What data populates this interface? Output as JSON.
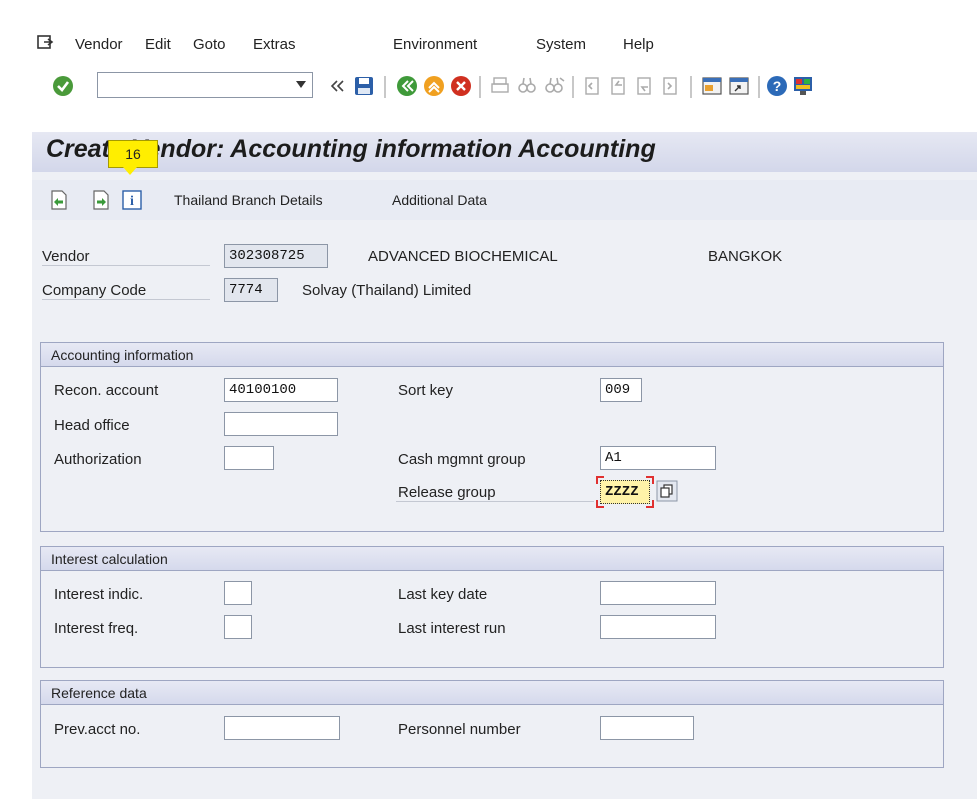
{
  "menu": {
    "items": [
      "Vendor",
      "Edit",
      "Goto",
      "Extras",
      "Environment",
      "System",
      "Help"
    ]
  },
  "toolbar": {
    "command_field_value": "",
    "icons": [
      "enter-icon",
      "command-dropdown-icon",
      "collapse-icon",
      "save-icon",
      "back-icon",
      "exit-icon",
      "cancel-icon",
      "print-icon",
      "find-icon",
      "find-next-icon",
      "first-page-icon",
      "previous-page-icon",
      "next-page-icon",
      "last-page-icon",
      "new-session-icon",
      "shortcut-icon",
      "help-icon",
      "layout-icon"
    ]
  },
  "screen": {
    "title": "Create Vendor: Accounting information Accounting",
    "tooltip": "16"
  },
  "app_toolbar": {
    "icons": [
      "previous-screen-icon",
      "next-screen-icon",
      "info-icon"
    ],
    "buttons": [
      "Thailand Branch Details",
      "Additional Data"
    ]
  },
  "header": {
    "vendor_label": "Vendor",
    "vendor_number": "302308725",
    "vendor_name": "ADVANCED BIOCHEMICAL",
    "vendor_city": "BANGKOK",
    "company_code_label": "Company Code",
    "company_code": "7774",
    "company_name": "Solvay (Thailand) Limited"
  },
  "accounting_info": {
    "title": "Accounting information",
    "recon_account_label": "Recon. account",
    "recon_account": "40100100",
    "head_office_label": "Head office",
    "head_office": "",
    "authorization_label": "Authorization",
    "authorization": "",
    "sort_key_label": "Sort key",
    "sort_key": "009",
    "cash_mgmt_group_label": "Cash mgmnt group",
    "cash_mgmt_group": "A1",
    "release_group_label": "Release group",
    "release_group": "ZZZZ"
  },
  "interest_calc": {
    "title": "Interest calculation",
    "interest_indic_label": "Interest indic.",
    "interest_indic": "",
    "interest_freq_label": "Interest freq.",
    "interest_freq": "",
    "last_key_date_label": "Last key date",
    "last_key_date": "",
    "last_interest_run_label": "Last interest run",
    "last_interest_run": ""
  },
  "reference_data": {
    "title": "Reference data",
    "prev_acct_no_label": "Prev.acct no.",
    "prev_acct_no": "",
    "personnel_number_label": "Personnel number",
    "personnel_number": ""
  },
  "colors": {
    "screen_bg": "#eef0f5",
    "title_bar": "#d3d7ea",
    "tooltip": "#ffee00",
    "required_marker": "#e03030",
    "focused_field": "#fff3a8"
  }
}
